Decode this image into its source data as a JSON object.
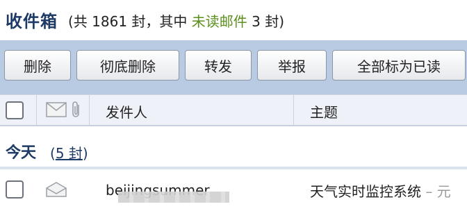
{
  "header": {
    "title": "收件箱",
    "summary_prefix": "(共 1861 封，其中 ",
    "unread_link": "未读邮件",
    "summary_suffix": " 3 封)"
  },
  "toolbar": {
    "buttons": [
      "删除",
      "彻底删除",
      "转发",
      "举报",
      "全部标为已读"
    ]
  },
  "list_header": {
    "from_label": "发件人",
    "subject_label": "主题"
  },
  "group": {
    "title": "今天",
    "count_prefix": "(",
    "count_link": "5 封",
    "count_suffix": ")"
  },
  "rows": [
    {
      "sender": "beijingsummer",
      "subject": "天气实时监控系统",
      "subject_trail": " – 元"
    }
  ],
  "colors": {
    "title": "#1d3a66",
    "unread_link": "#5a8f1c",
    "toolbar_bg": "#b9cbe3"
  }
}
